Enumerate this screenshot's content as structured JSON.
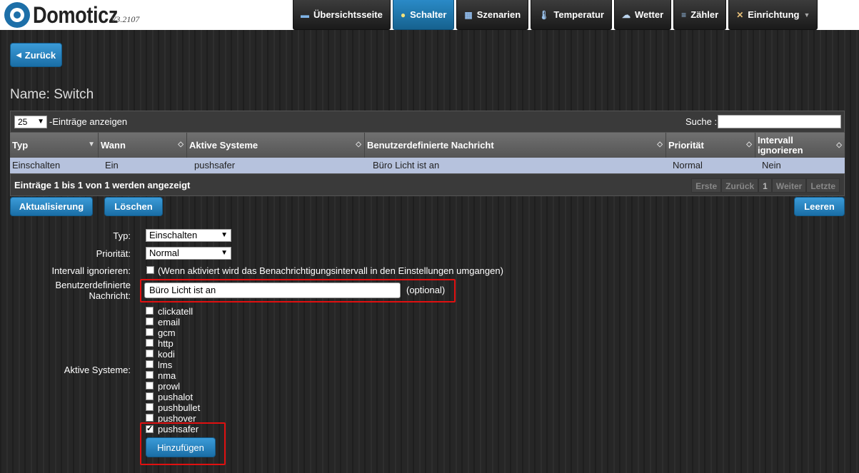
{
  "header": {
    "app_name": "Domoticz",
    "version": "V3.2107",
    "nav": [
      {
        "label": "Übersichtsseite",
        "icon": "dashboard-icon"
      },
      {
        "label": "Schalter",
        "icon": "lightbulb-icon",
        "active": true
      },
      {
        "label": "Szenarien",
        "icon": "scenes-icon"
      },
      {
        "label": "Temperatur",
        "icon": "thermometer-icon"
      },
      {
        "label": "Wetter",
        "icon": "cloud-rain-icon"
      },
      {
        "label": "Zähler",
        "icon": "meter-icon"
      },
      {
        "label": "Einrichtung",
        "icon": "tools-icon",
        "has_dropdown": true
      }
    ]
  },
  "back_button": "Zurück",
  "page_title": "Name: Switch",
  "table": {
    "page_size": "25",
    "page_size_label": "-Einträge anzeigen",
    "search_label": "Suche :",
    "search_value": "",
    "columns": [
      "Typ",
      "Wann",
      "Aktive Systeme",
      "Benutzerdefinierte Nachricht",
      "Priorität",
      "Intervall ignorieren"
    ],
    "rows": [
      [
        "Einschalten",
        "Ein",
        "pushsafer",
        "Büro Licht ist an",
        "Normal",
        "Nein"
      ]
    ],
    "info": "Einträge 1 bis 1 von 1 werden angezeigt",
    "pager": [
      "Erste",
      "Zurück",
      "1",
      "Weiter",
      "Letzte"
    ]
  },
  "actions": {
    "update": "Aktualisierung",
    "delete": "Löschen",
    "clear": "Leeren"
  },
  "form": {
    "type_label": "Typ:",
    "type_value": "Einschalten",
    "priority_label": "Priorität:",
    "priority_value": "Normal",
    "ignore_label": "Intervall ignorieren:",
    "ignore_text": "(Wenn aktiviert wird das Benachrichtigungsintervall in den Einstellungen umgangen)",
    "message_label_1": "Benutzerdefinierte",
    "message_label_2": "Nachricht:",
    "message_value": "Büro Licht ist an",
    "message_optional": "(optional)",
    "systems_label": "Aktive Systeme:",
    "systems": [
      {
        "name": "clickatell",
        "checked": false
      },
      {
        "name": "email",
        "checked": false
      },
      {
        "name": "gcm",
        "checked": false
      },
      {
        "name": "http",
        "checked": false
      },
      {
        "name": "kodi",
        "checked": false
      },
      {
        "name": "lms",
        "checked": false
      },
      {
        "name": "nma",
        "checked": false
      },
      {
        "name": "prowl",
        "checked": false
      },
      {
        "name": "pushalot",
        "checked": false
      },
      {
        "name": "pushbullet",
        "checked": false
      },
      {
        "name": "pushover",
        "checked": false
      },
      {
        "name": "pushsafer",
        "checked": true
      }
    ],
    "add_button": "Hinzufügen"
  }
}
